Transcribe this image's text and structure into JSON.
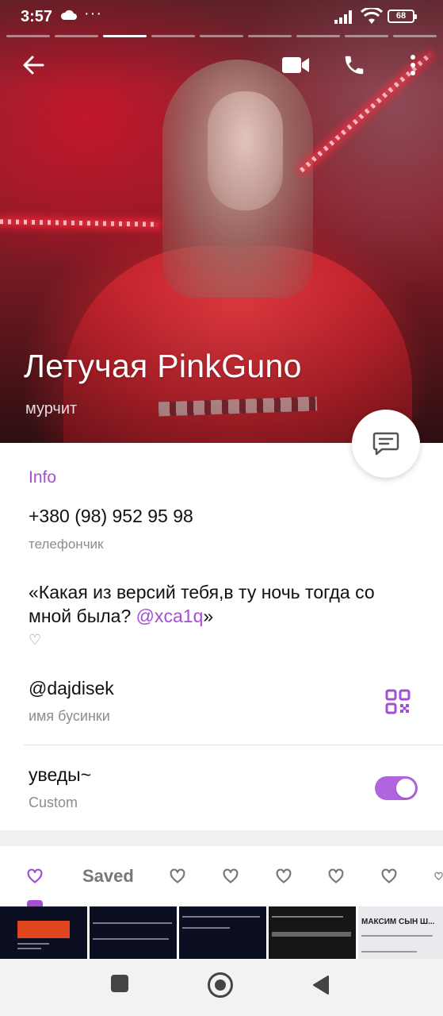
{
  "status_bar": {
    "time": "3:57",
    "more": "···",
    "battery": "68"
  },
  "profile": {
    "name": "Летучая PinkGuno",
    "status": "мурчит"
  },
  "info": {
    "section_title": "Info",
    "phone": "+380 (98) 952 95 98",
    "phone_label": "телефончик",
    "bio_text": "«Какая из версий тебя,в ту ночь тогда со мной была? ",
    "bio_mention": "@xca1q",
    "bio_end": "»",
    "bio_label": "♡",
    "username": "@dajdisek",
    "username_label": "имя бусинки",
    "notifications": "уведы~",
    "notifications_label": "Custom",
    "notifications_enabled": true
  },
  "tabs": {
    "items": [
      "♡",
      "Saved",
      "♡",
      "♡",
      "♡",
      "♡",
      "♡",
      "♡"
    ],
    "active_index": 0
  },
  "media": {
    "thumb5_title": "МАКСИМ СЫН Ш..."
  },
  "colors": {
    "accent": "#a24fd6",
    "toggle_on": "#b064e0"
  }
}
